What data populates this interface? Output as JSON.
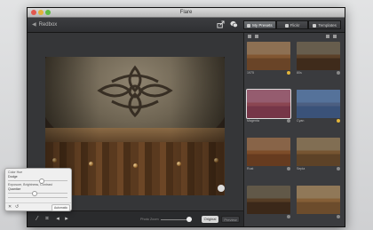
{
  "window": {
    "title": "Flare"
  },
  "toolbar": {
    "back_label": "Redbox",
    "share_icon": "share-icon",
    "comment_icon": "speech-bubble-icon",
    "tabs": [
      {
        "label": "My Presets",
        "icon": "person-icon"
      },
      {
        "label": "Flickr",
        "icon": "flickr-icon"
      },
      {
        "label": "Templates",
        "icon": "grid-icon"
      }
    ]
  },
  "presets": [
    {
      "label": "1975",
      "starred": true
    },
    {
      "label": "80s",
      "starred": false
    },
    {
      "label": "Magenta",
      "starred": false
    },
    {
      "label": "Cyan",
      "starred": true
    },
    {
      "label": "Rust",
      "starred": false
    },
    {
      "label": "Sepia",
      "starred": false
    },
    {
      "label": "",
      "starred": false
    },
    {
      "label": "",
      "starred": false
    }
  ],
  "bottombar": {
    "zoom_label": "Photo Zoom",
    "zoom_value": 0.9,
    "original_label": "Original",
    "preview_label": "Preview"
  },
  "popover": {
    "color_label": "Color Hue",
    "color_value": "Dodge",
    "exposure_label": "Exposure, Brightness, Contrast",
    "exposure_value": "Quantize",
    "auto_label": "Automatic"
  },
  "colors": {
    "selected_tab": "#6d7073",
    "star": "#e3b53a",
    "window": "#2b2c2e"
  }
}
